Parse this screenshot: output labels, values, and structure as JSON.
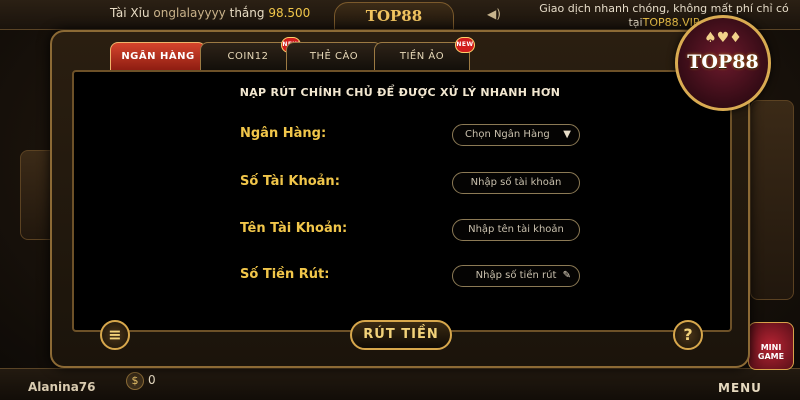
{
  "topbar": {
    "ticker_prefix": "Tài Xỉu",
    "ticker_user": "onglalayyyy",
    "ticker_verb": "thắng",
    "ticker_amount": "98.500",
    "logo_text": "TOP88",
    "promo_line1": "Giao dịch nhanh chóng, không mất phí chỉ có",
    "promo_line2_prefix": "tại",
    "promo_site": "TOP88.VIP"
  },
  "brand": {
    "logo_text": "TOP88",
    "cards_glyph": "♠♥♦"
  },
  "tabs": [
    {
      "label": "NGÂN HÀNG",
      "active": true,
      "new": false
    },
    {
      "label": "COIN12",
      "active": false,
      "new": true
    },
    {
      "label": "THẺ CÀO",
      "active": false,
      "new": false
    },
    {
      "label": "TIỀN ẢO",
      "active": false,
      "new": true
    }
  ],
  "new_badge_label": "NEW",
  "form": {
    "title": "NẠP RÚT CHÍNH CHỦ ĐỂ ĐƯỢC XỬ LÝ NHANH HƠN",
    "bank_label": "Ngân Hàng:",
    "bank_value": "Chọn Ngân Hàng",
    "account_no_label": "Số Tài Khoản:",
    "account_no_placeholder": "Nhập số tài  khoản",
    "account_name_label": "Tên Tài Khoản:",
    "account_name_placeholder": "Nhập tên tài khoản",
    "amount_label": "Số Tiền Rút:",
    "amount_placeholder": "Nhập số tiền rút",
    "submit_label": "RÚT TIỀN",
    "help_label": "?"
  },
  "bottombar": {
    "username": "Alanina76",
    "currency_symbol": "$",
    "balance": "0",
    "menu_label": "MENU",
    "mini_game_label": "MINI GAME"
  },
  "colors": {
    "accent_gold": "#f1c64a",
    "tab_active": "#c0392b",
    "panel_bg": "#000000"
  },
  "icons": {
    "caret": "▼",
    "edit": "✎",
    "notes": "≡",
    "volume": "◀)"
  }
}
